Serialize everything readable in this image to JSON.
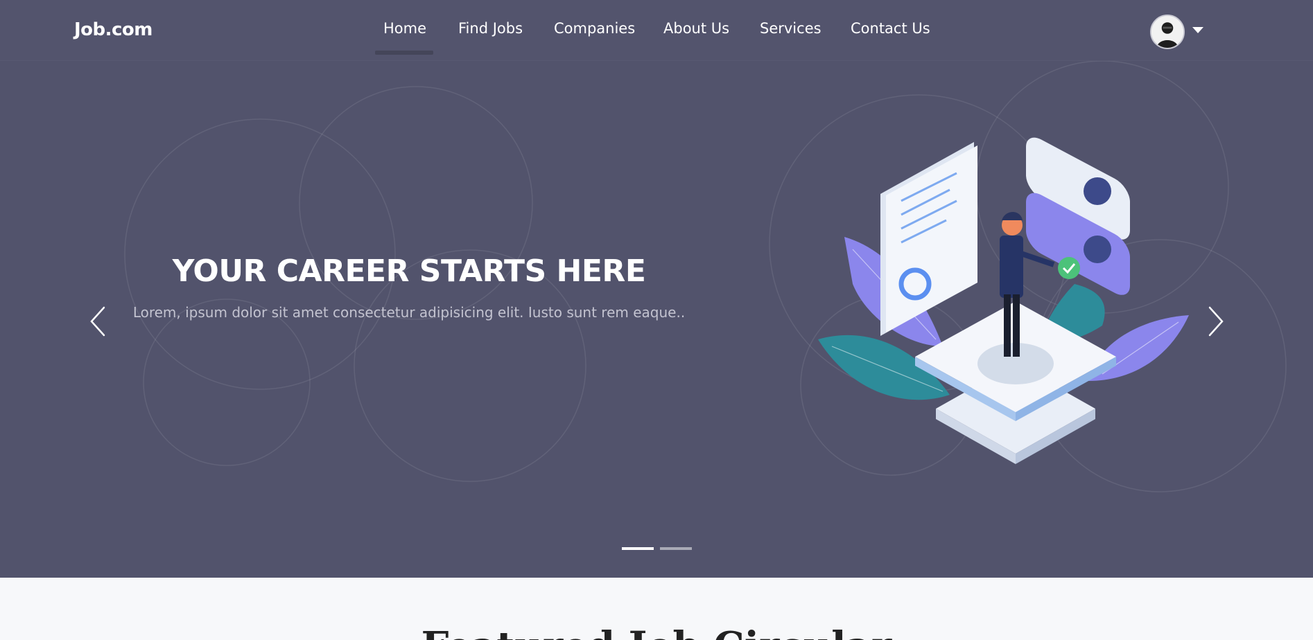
{
  "brand": "Job.com",
  "nav": {
    "links": [
      "Home",
      "Find Jobs",
      "Companies",
      "About Us",
      "Services",
      "Contact Us"
    ],
    "active": "Home"
  },
  "user_menu": {
    "avatar_icon": "user-avatar",
    "caret_icon": "caret-down-icon"
  },
  "hero": {
    "title": "YOUR CAREER STARTS HERE",
    "subtitle": "Lorem, ipsum dolor sit amet consectetur adipisicing elit. Iusto sunt rem eaque..",
    "prev_icon": "chevron-left-icon",
    "next_icon": "chevron-right-icon",
    "slides": 2,
    "active_slide": 1
  },
  "next_section": {
    "title": "Featured Job Circular"
  },
  "colors": {
    "hero_bg": "#52536c",
    "accent_purple": "#8b86ec",
    "accent_teal": "#2d8c9a",
    "check_green": "#4cc27a"
  }
}
